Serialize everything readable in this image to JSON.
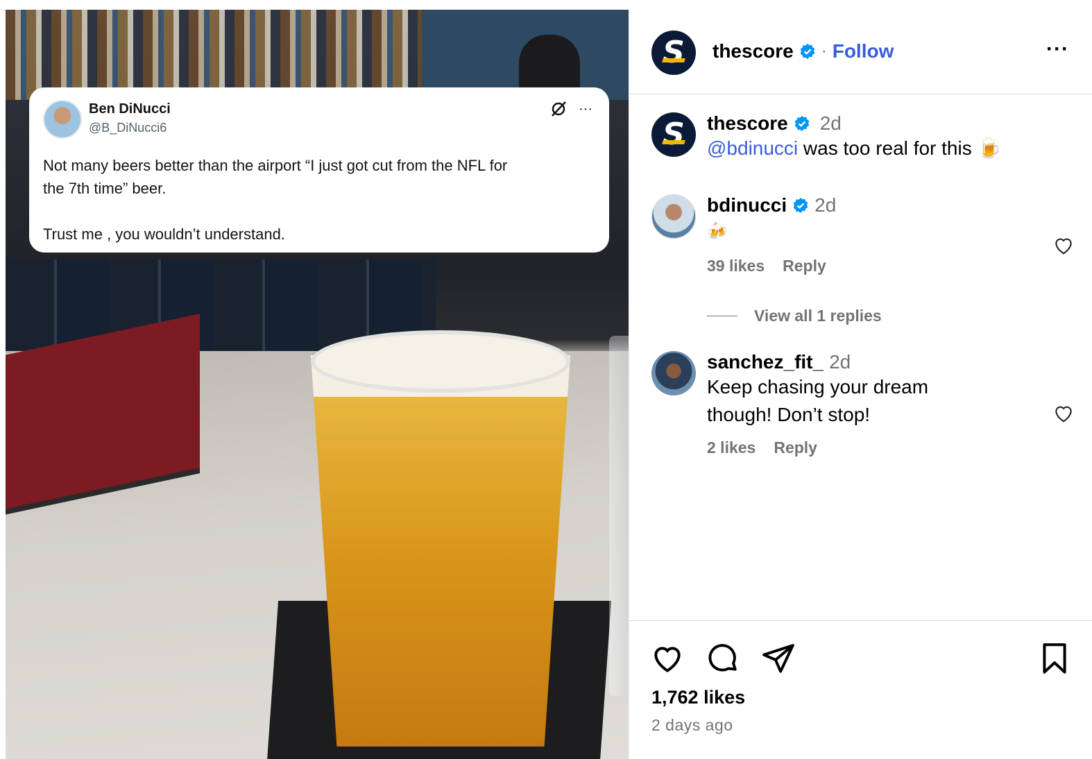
{
  "tweet": {
    "name": "Ben DiNucci",
    "handle": "@B_DiNucci6",
    "text": "Not many beers better than the airport “I just got cut from the NFL for\nthe 7th time” beer.\n\nTrust me , you wouldn’t understand.",
    "more_label": "···"
  },
  "header": {
    "username": "thescore",
    "separator": "·",
    "follow_label": "Follow",
    "more_label": "···"
  },
  "caption": {
    "username": "thescore",
    "time": "2d",
    "mention": "@bdinucci",
    "text": " was too real for this 🍺"
  },
  "comments": [
    {
      "username": "bdinucci",
      "time": "2d",
      "text": "🍻",
      "likes": "39 likes",
      "reply_label": "Reply"
    },
    {
      "username": "sanchez_fit_",
      "time": "2d",
      "text": "Keep chasing your dream though! Don’t stop!",
      "likes": "2 likes",
      "reply_label": "Reply"
    }
  ],
  "view_replies": "View all 1 replies",
  "post": {
    "likes": "1,762 likes",
    "posted": "2 days ago"
  },
  "colors": {
    "link": "#3a5bdc",
    "verified": "#0095f6",
    "muted": "#737373"
  },
  "icons": [
    "verified-icon",
    "heart-icon",
    "comment-icon",
    "share-icon",
    "bookmark-icon",
    "more-icon",
    "twitter-x-icon"
  ]
}
